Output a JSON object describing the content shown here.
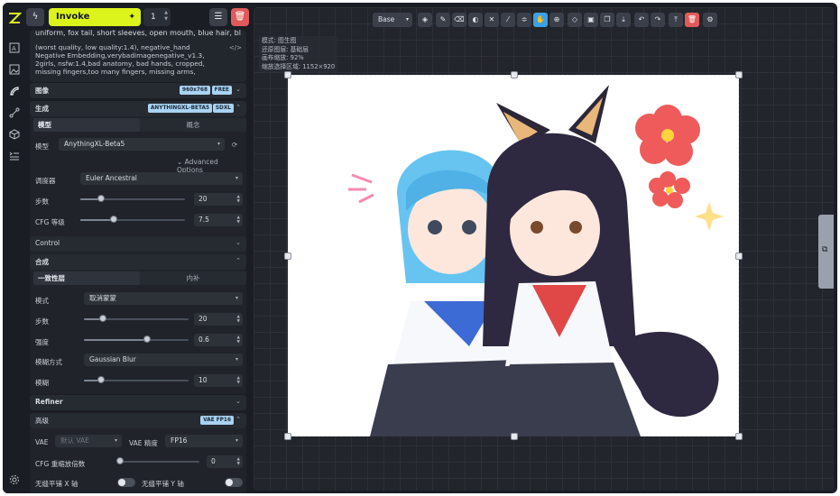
{
  "topbar": {
    "invoke_label": "Invoke",
    "iterations": "1"
  },
  "prompt": {
    "positive": "uniform, fox tail, short sleeves, open mouth, blue hair, blue",
    "negative": "(worst quality, low quality:1.4), negative_hand Negative Embedding,verybadimagenegative_v1.3, 2girls, nsfw:1.4,bad anatomy, bad hands, cropped, missing fingers,too many fingers, missing arms,"
  },
  "image_section": {
    "title": "图像",
    "size_badge": "960x768",
    "free_badge": "FREE"
  },
  "generation": {
    "title": "生成",
    "model_badge": "ANYTHINGXL-BETA5",
    "arch_badge": "SDXL",
    "tab_model": "模型",
    "tab_concepts": "概念",
    "model_label": "模型",
    "model_value": "AnythingXL-Beta5",
    "advanced_label": "Advanced Options",
    "scheduler_label": "调度器",
    "scheduler_value": "Euler Ancestral",
    "steps_label": "步数",
    "steps_value": "20",
    "steps_fraction": 0.2,
    "cfg_label": "CFG 等级",
    "cfg_value": "7.5",
    "cfg_fraction": 0.32
  },
  "control": {
    "title": "Control"
  },
  "compositing": {
    "title": "合成",
    "tab_coherence": "一致性层",
    "tab_infill": "内补",
    "mode_label": "模式",
    "mode_value": "取消蒙蒙",
    "steps_label": "步数",
    "steps_value": "20",
    "steps_fraction": 0.18,
    "strength_label": "强度",
    "strength_value": "0.6",
    "strength_fraction": 0.6,
    "blur_method_label": "模糊方式",
    "blur_method_value": "Gaussian Blur",
    "blur_label": "模糊",
    "blur_value": "10",
    "blur_fraction": 0.16
  },
  "refiner": {
    "title": "Refiner"
  },
  "advanced": {
    "title": "高级",
    "vae_badge": "VAE FP16",
    "vae_label": "VAE",
    "vae_placeholder": "默认 VAE",
    "precision_label": "VAE 精度",
    "precision_value": "FP16",
    "cfg_rescale_label": "CFG 重缩放倍数",
    "cfg_rescale_value": "0",
    "cfg_rescale_fraction": 0.0,
    "seamless_x_label": "无缝平铺 X 轴",
    "seamless_y_label": "无缝平铺 Y 轴"
  },
  "canvas": {
    "layer_select": "Base",
    "info_lines": [
      "模式: 图生图",
      "还原图层: 基础层",
      "画布缩放: 92%",
      "缩放选择区域: 1152×920"
    ]
  },
  "icons": [
    "logo-icon",
    "text-to-image-icon",
    "image-to-image-icon",
    "unified-canvas-icon",
    "workflow-icon",
    "models-icon",
    "queue-icon",
    "settings-icon"
  ]
}
